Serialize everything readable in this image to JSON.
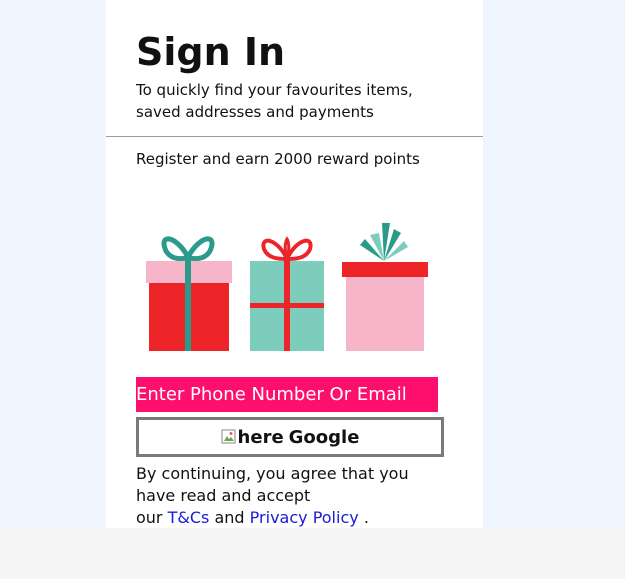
{
  "signin": {
    "title": "Sign In",
    "subtitle_line1": "To quickly find your favourites items,",
    "subtitle_line2": "saved addresses and payments",
    "reward_text": "Register and earn 2000 reward points",
    "phone_button_label": "Enter Phone Number Or Email",
    "google_button": {
      "image_alt_text": "here",
      "label": "Google"
    },
    "terms": {
      "line1": "By continuing, you agree that you",
      "line2": "have read and accept",
      "prefix": "our",
      "tnc_link": "T&Cs",
      "and": "and",
      "privacy_link": "Privacy Policy",
      "suffix": "."
    }
  },
  "illustration": {
    "icons": [
      "gift-box-icon",
      "gift-box-icon",
      "gift-box-icon"
    ],
    "colors": {
      "red": "#ed2428",
      "teal": "#7dcdbd",
      "pink": "#f7b5c9",
      "dark_teal": "#2a9a8a"
    }
  },
  "colors": {
    "page_background": "#eff6ff",
    "card_background": "#ffffff",
    "phone_button": "#ff0f6d",
    "link": "#1a1ad6",
    "google_border": "#7a7a7a",
    "bottom_band": "#f5f5f5"
  }
}
